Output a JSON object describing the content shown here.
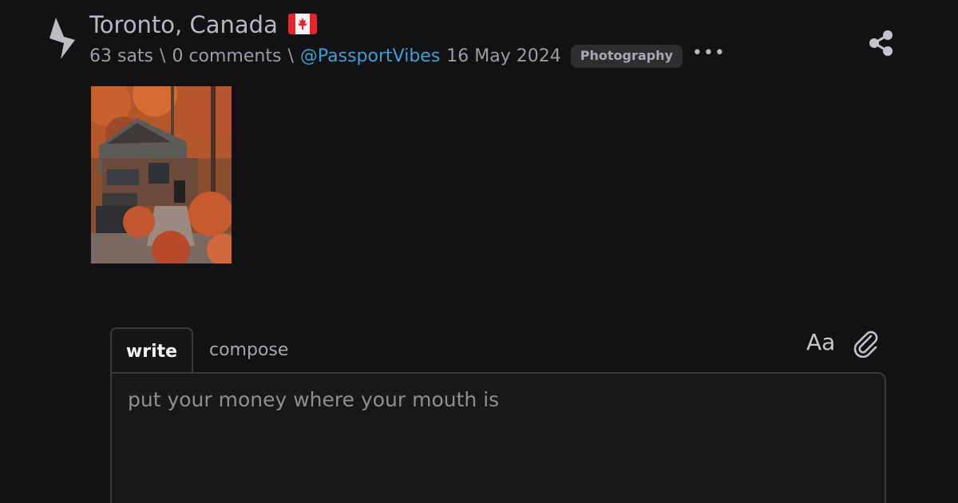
{
  "post": {
    "title": "Toronto, Canada",
    "flag_icon": "canada-flag-icon",
    "sats": "63 sats",
    "separator1": "\\",
    "comments": "0 comments",
    "separator2": "\\",
    "user": "@PassportVibes",
    "date": "16 May 2024",
    "tag": "Photography",
    "more_icon": "more-dots-icon",
    "share_icon": "share-icon",
    "image": {
      "icon": "autumn-house-photo"
    }
  },
  "reply": {
    "tabs": [
      {
        "label": "write",
        "active": true
      },
      {
        "label": "compose",
        "active": false
      }
    ],
    "format_label": "Aa",
    "attach_icon": "paperclip-icon",
    "placeholder": "put your money where your mouth is"
  },
  "colors": {
    "background": "#121214",
    "link": "#3d9fd4",
    "tag_bg": "#2e2e31"
  }
}
